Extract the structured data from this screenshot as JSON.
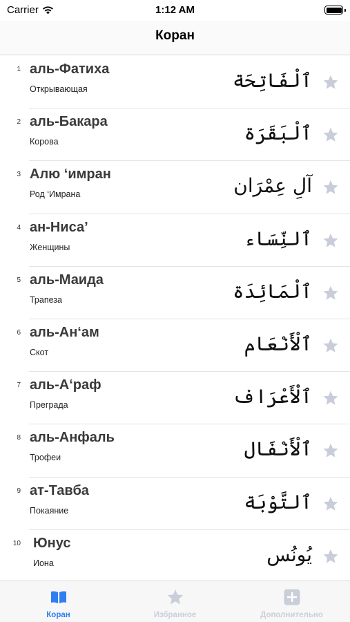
{
  "status_bar": {
    "carrier": "Carrier",
    "time": "1:12 AM"
  },
  "nav": {
    "title": "Коран"
  },
  "colors": {
    "accent": "#2f7ff0",
    "star": "#c9ccd9",
    "inactive_tab": "#c9cfd8"
  },
  "surahs": [
    {
      "number": "1",
      "name": "аль-Фатиха",
      "meaning": "Открывающая",
      "arabic": "ٱلْفَاتِحَة",
      "icon": "star-icon"
    },
    {
      "number": "2",
      "name": "аль-Бакара",
      "meaning": "Корова",
      "arabic": "ٱلْبَقَرَة",
      "icon": "star-icon"
    },
    {
      "number": "3",
      "name": "Алю ‘имран",
      "meaning": "Род ‘Имрана",
      "arabic": "آلِ عِمْرَان",
      "icon": "star-icon"
    },
    {
      "number": "4",
      "name": "ан-Ниса’",
      "meaning": "Женщины",
      "arabic": "ٱلنِّسَاء",
      "icon": "star-icon"
    },
    {
      "number": "5",
      "name": "аль-Маида",
      "meaning": "Трапеза",
      "arabic": "ٱلْمَائِدَة",
      "icon": "star-icon"
    },
    {
      "number": "6",
      "name": "аль-Ан‘ам",
      "meaning": "Скот",
      "arabic": "ٱلْأَنْعَام",
      "icon": "star-icon"
    },
    {
      "number": "7",
      "name": "аль-А‘раф",
      "meaning": "Преграда",
      "arabic": "ٱلْأَعْرَاف",
      "icon": "star-icon"
    },
    {
      "number": "8",
      "name": "аль-Анфаль",
      "meaning": "Трофеи",
      "arabic": "ٱلْأَنْفَال",
      "icon": "star-icon"
    },
    {
      "number": "9",
      "name": "ат-Тавба",
      "meaning": "Покаяние",
      "arabic": "ٱلتَّوْبَة",
      "icon": "star-icon"
    },
    {
      "number": "10",
      "name": "Юнус",
      "meaning": "Иона",
      "arabic": "يُونُس",
      "icon": "star-icon"
    }
  ],
  "tabs": [
    {
      "label": "Коран",
      "icon": "book-icon",
      "active": true
    },
    {
      "label": "Избранное",
      "icon": "star-icon",
      "active": false
    },
    {
      "label": "Дополнительно",
      "icon": "plus-icon",
      "active": false
    }
  ]
}
